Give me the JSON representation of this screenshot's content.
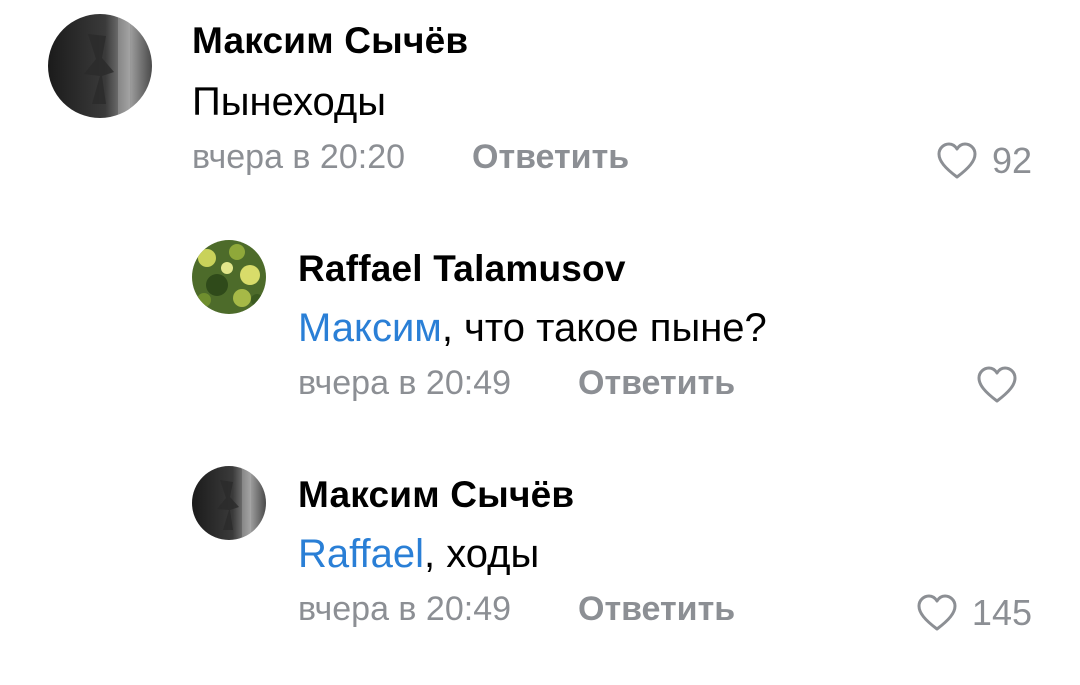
{
  "comments": [
    {
      "author": "Максим Сычёв",
      "mention": "",
      "text": "Пынеходы",
      "time": "вчера в 20:20",
      "reply_label": "Ответить",
      "likes": "92"
    },
    {
      "author": "Raffael Talamusov",
      "mention": "Максим",
      "text": ", что такое пыне?",
      "time": "вчера в 20:49",
      "reply_label": "Ответить",
      "likes": ""
    },
    {
      "author": "Максим Сычёв",
      "mention": "Raffael",
      "text": ", ходы",
      "time": "вчера в 20:49",
      "reply_label": "Ответить",
      "likes": "145"
    }
  ],
  "colors": {
    "mention": "#2a7fd6",
    "meta": "#8c8f94",
    "text": "#000000"
  },
  "icons": [
    "avatar",
    "heart-icon"
  ]
}
